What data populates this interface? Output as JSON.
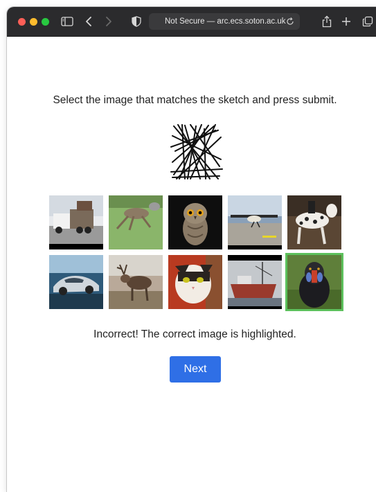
{
  "browser": {
    "address_prefix": "Not Secure — ",
    "address_host": "arc.ecs.soton.ac.uk"
  },
  "task": {
    "prompt": "Select the image that matches the sketch and press submit.",
    "result": "Incorrect! The correct image is highlighted.",
    "next_label": "Next"
  },
  "images": [
    {
      "subject": "tow truck"
    },
    {
      "subject": "running deer"
    },
    {
      "subject": "owl"
    },
    {
      "subject": "small airplane"
    },
    {
      "subject": "spotted horse with rider"
    },
    {
      "subject": "silver sports car"
    },
    {
      "subject": "elk"
    },
    {
      "subject": "cat"
    },
    {
      "subject": "ship at dock"
    },
    {
      "subject": "mandrill",
      "correct": true
    }
  ]
}
